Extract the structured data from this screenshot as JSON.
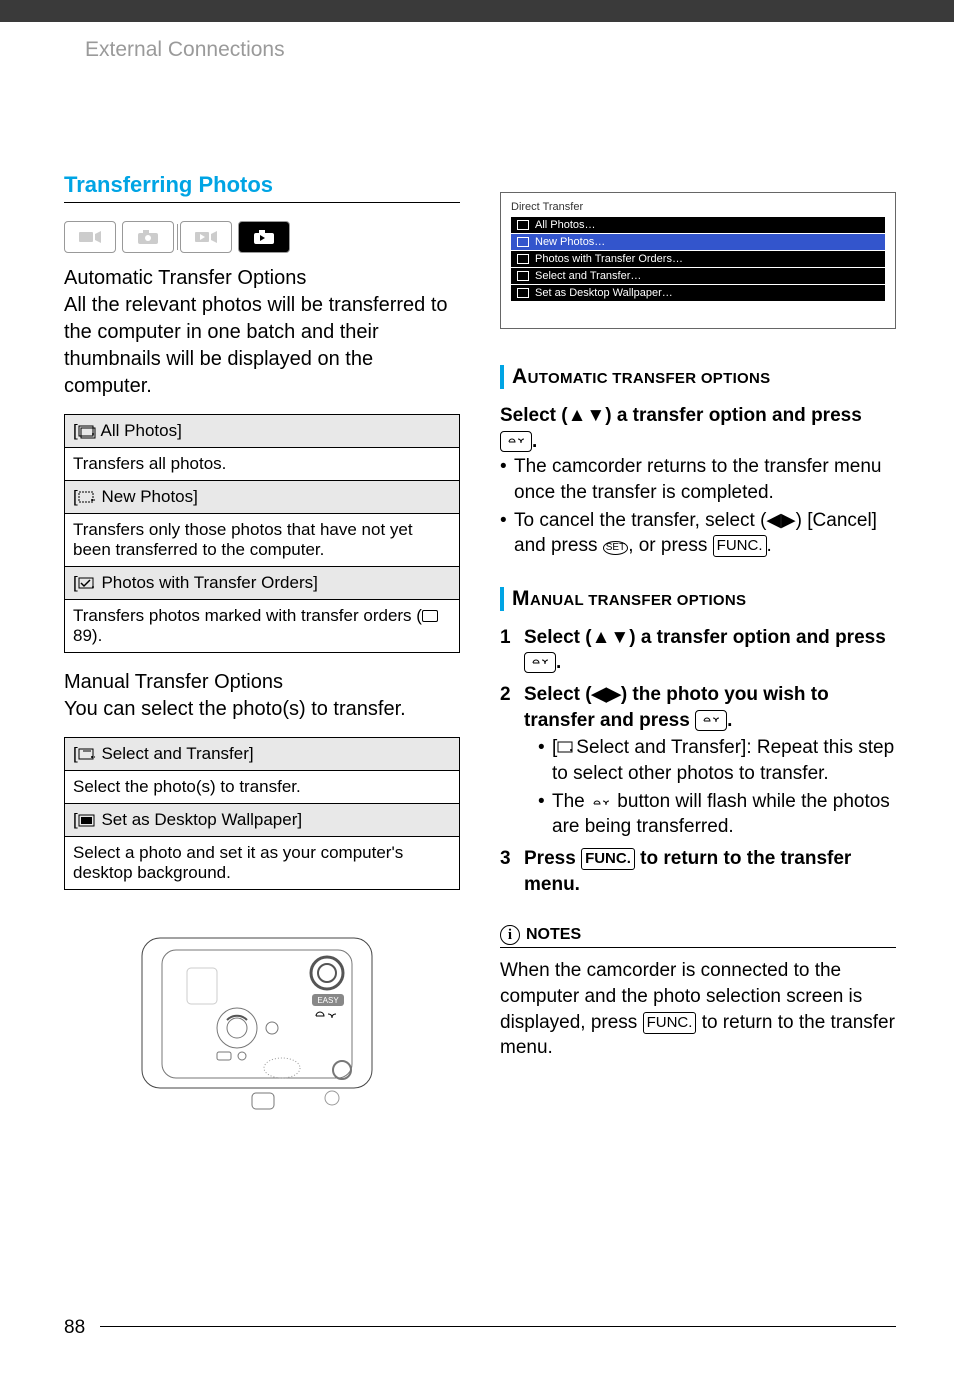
{
  "header": {
    "breadcrumb": "External Connections"
  },
  "section_title": "Transferring Photos",
  "auto_heading": "Automatic Transfer Options",
  "auto_body": "All the relevant photos will be transferred to the computer in one batch and their thumbnails will be displayed on the computer.",
  "auto_table": [
    {
      "label": "All Photos]",
      "desc": "Transfers all photos."
    },
    {
      "label": "New Photos]",
      "desc": "Transfers only those photos that have not yet been transferred to the computer."
    },
    {
      "label": "Photos with Transfer Orders]",
      "desc_pre": "Transfers photos marked with transfer orders (",
      "desc_post": " 89)."
    }
  ],
  "manual_heading": "Manual Transfer Options",
  "manual_body": "You can select the photo(s) to transfer.",
  "manual_table": [
    {
      "label": "Select and Transfer]",
      "desc": "Select the photo(s) to transfer."
    },
    {
      "label": "Set as Desktop Wallpaper]",
      "desc": "Select a photo and set it as your computer's desktop background."
    }
  ],
  "screenshot": {
    "title": "Direct Transfer",
    "rows": [
      "All Photos…",
      "New Photos…",
      "Photos with Transfer Orders…",
      "Select and Transfer…",
      "Set as Desktop Wallpaper…"
    ]
  },
  "auto_bar": "Automatic transfer options",
  "auto_instr_lead_pre": "Select (",
  "auto_instr_lead_post": ") a transfer option and press",
  "auto_bullets": {
    "b1": "The camcorder returns to the transfer menu once the transfer is completed.",
    "b2_pre": "To cancel the transfer, select (",
    "b2_mid": ") [Cancel] and press ",
    "b2_post": ", or press "
  },
  "manual_bar": "Manual transfer options",
  "steps": {
    "s1_pre": "Select (",
    "s1_post": ") a transfer option and press",
    "s2_pre": "Select (",
    "s2_mid": ") the photo you wish to transfer and press",
    "s2_sub1": "Select and Transfer]: Repeat this step to select other photos to transfer.",
    "s2_sub2_pre": "The ",
    "s2_sub2_post": " button will flash while the photos are being transferred.",
    "s3_pre": "Press",
    "s3_post": "to return to the transfer menu."
  },
  "notes_label": "NOTES",
  "notes_body_pre": "When the camcorder is connected to the computer and the photo selection screen is displayed, press",
  "notes_body_post": "to return to the transfer menu.",
  "func_label": "FUNC.",
  "set_label": "SET",
  "page": "88"
}
